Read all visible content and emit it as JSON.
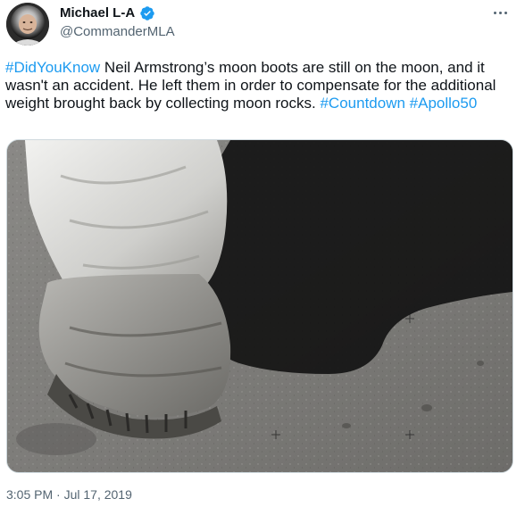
{
  "author": {
    "display_name": "Michael L-A",
    "handle": "@CommanderMLA",
    "verified": true,
    "avatar_icon": "astronaut-avatar"
  },
  "menu_icon": "more-horizontal-icon",
  "tweet": {
    "segments": [
      {
        "text": "#DidYouKnow",
        "hashtag": true
      },
      {
        "text": " Neil Armstrong’s moon boots are still on the moon, and it wasn't an accident. He left them in order to compensate for the additional weight brought back by collecting moon rocks. ",
        "hashtag": false
      },
      {
        "text": "#Countdown",
        "hashtag": true
      },
      {
        "text": " ",
        "hashtag": false
      },
      {
        "text": "#Apollo50",
        "hashtag": true
      }
    ],
    "timestamp": "3:05 PM · Jul 17, 2019"
  },
  "media": {
    "subject": "astronaut-boot-on-lunar-surface-photo"
  },
  "colors": {
    "link": "#1d9bf0",
    "text": "#0f1419",
    "secondary": "#536471",
    "verified": "#1d9bf0"
  }
}
